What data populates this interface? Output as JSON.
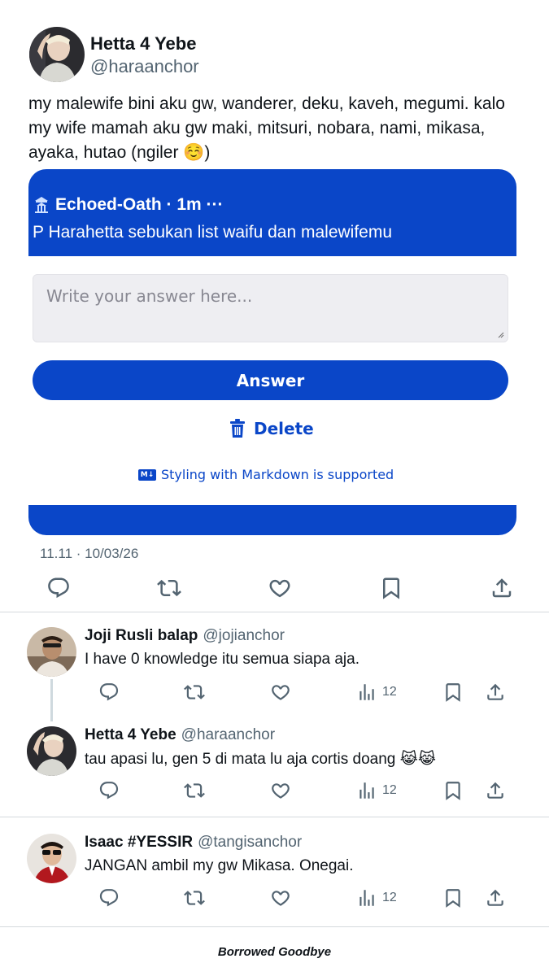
{
  "main_tweet": {
    "name": "Hetta 4 Yebe",
    "handle": "@haraanchor",
    "text": "my malewife bini aku gw, wanderer, deku, kaveh, megumi. kalo my wife mamah aku gw maki, mitsuri, nobara, nami, mikasa, ayaka, hutao (ngiler ☺️)",
    "timestamp": "11.11 · 10/03/26"
  },
  "ngl_card": {
    "sender_meta": "Echoed-Oath · 1m ···",
    "question": "P Harahetta sebukan list waifu dan malewifemu",
    "answer_placeholder": "Write your answer here...",
    "answer_button": "Answer",
    "delete_button": "Delete",
    "markdown_badge": "M↓",
    "markdown_note": "Styling with Markdown is supported"
  },
  "replies": [
    {
      "name": "Joji Rusli balap",
      "handle": "@jojianchor",
      "text": "I have 0 knowledge itu semua siapa aja.",
      "views": "12"
    },
    {
      "name": "Hetta 4 Yebe",
      "handle": "@haraanchor",
      "text": "tau apasi lu, gen 5 di mata lu aja cortis doang 😹😹",
      "views": "12"
    },
    {
      "name": "Isaac #YESSIR",
      "handle": "@tangisanchor",
      "text": "JANGAN ambil my gw Mikasa. Onegai.",
      "views": "12"
    }
  ],
  "footer": {
    "caption": "Borrowed Goodbye"
  },
  "colors": {
    "accent": "#0a46c8",
    "text": "#0f1419",
    "muted": "#536471",
    "divider": "#d5d9dd"
  }
}
